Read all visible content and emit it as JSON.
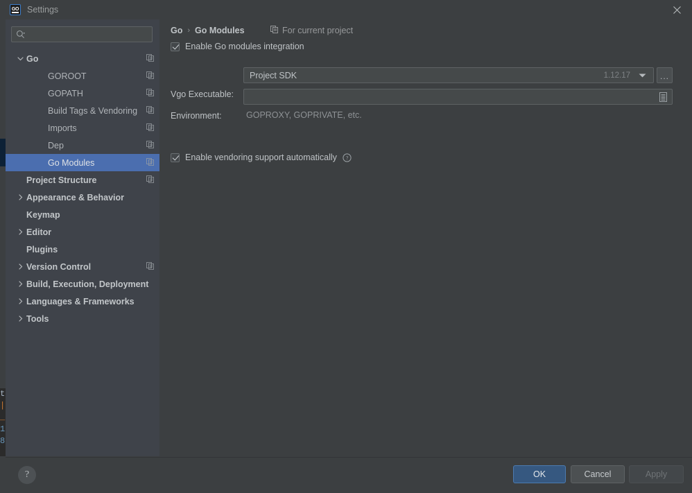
{
  "window": {
    "title": "Settings",
    "app_icon": "goland-icon",
    "close_icon": "close-icon"
  },
  "background_editor": {
    "visible_code_fragments": [
      "t",
      "",
      "_",
      "1",
      "8"
    ]
  },
  "sidebar": {
    "search": {
      "value": "",
      "placeholder": "",
      "icon": "search-icon"
    },
    "tree": [
      {
        "label": "Go",
        "level": 0,
        "expander": "chevron-down",
        "selected": false,
        "copy_icon": true
      },
      {
        "label": "GOROOT",
        "level": 1,
        "expander": "none",
        "selected": false,
        "copy_icon": true
      },
      {
        "label": "GOPATH",
        "level": 1,
        "expander": "none",
        "selected": false,
        "copy_icon": true
      },
      {
        "label": "Build Tags & Vendoring",
        "level": 1,
        "expander": "none",
        "selected": false,
        "copy_icon": true
      },
      {
        "label": "Imports",
        "level": 1,
        "expander": "none",
        "selected": false,
        "copy_icon": true
      },
      {
        "label": "Dep",
        "level": 1,
        "expander": "none",
        "selected": false,
        "copy_icon": true
      },
      {
        "label": "Go Modules",
        "level": 1,
        "expander": "none",
        "selected": true,
        "copy_icon": true
      },
      {
        "label": "Project Structure",
        "level": 0,
        "expander": "none",
        "selected": false,
        "copy_icon": true
      },
      {
        "label": "Appearance & Behavior",
        "level": 0,
        "expander": "chevron-right",
        "selected": false,
        "copy_icon": false
      },
      {
        "label": "Keymap",
        "level": 0,
        "expander": "none",
        "selected": false,
        "copy_icon": false
      },
      {
        "label": "Editor",
        "level": 0,
        "expander": "chevron-right",
        "selected": false,
        "copy_icon": false
      },
      {
        "label": "Plugins",
        "level": 0,
        "expander": "none",
        "selected": false,
        "copy_icon": false
      },
      {
        "label": "Version Control",
        "level": 0,
        "expander": "chevron-right",
        "selected": false,
        "copy_icon": true
      },
      {
        "label": "Build, Execution, Deployment",
        "level": 0,
        "expander": "chevron-right",
        "selected": false,
        "copy_icon": false
      },
      {
        "label": "Languages & Frameworks",
        "level": 0,
        "expander": "chevron-right",
        "selected": false,
        "copy_icon": false
      },
      {
        "label": "Tools",
        "level": 0,
        "expander": "chevron-right",
        "selected": false,
        "copy_icon": false
      }
    ]
  },
  "main": {
    "breadcrumb": {
      "parent": "Go",
      "separator": "›",
      "current": "Go Modules"
    },
    "scope": {
      "icon": "copy-icon",
      "label": "For current project"
    },
    "enable_modules": {
      "label": "Enable Go modules integration",
      "checked": true
    },
    "vgo_executable": {
      "label": "Vgo Executable:",
      "value": "Project SDK",
      "version": "1.12.17",
      "dropdown_icon": "chevron-down-icon",
      "browse_label": "..."
    },
    "environment": {
      "label": "Environment:",
      "value": "",
      "placeholder": "",
      "editor_icon": "list-editor-icon",
      "hint": "GOPROXY, GOPRIVATE, etc."
    },
    "enable_vendoring": {
      "label": "Enable vendoring support automatically",
      "checked": true,
      "help_icon": "question-circle-icon"
    }
  },
  "footer": {
    "help": "?",
    "ok": "OK",
    "cancel": "Cancel",
    "apply": "Apply"
  },
  "colors": {
    "accent_selection": "#4b6eaf",
    "ok_button": "#365880",
    "panel_bg": "#3c3f41",
    "sidebar_bg": "#3f434a",
    "field_bg": "#45494a",
    "text": "#bfc3c6",
    "muted_text": "#8e9295"
  }
}
